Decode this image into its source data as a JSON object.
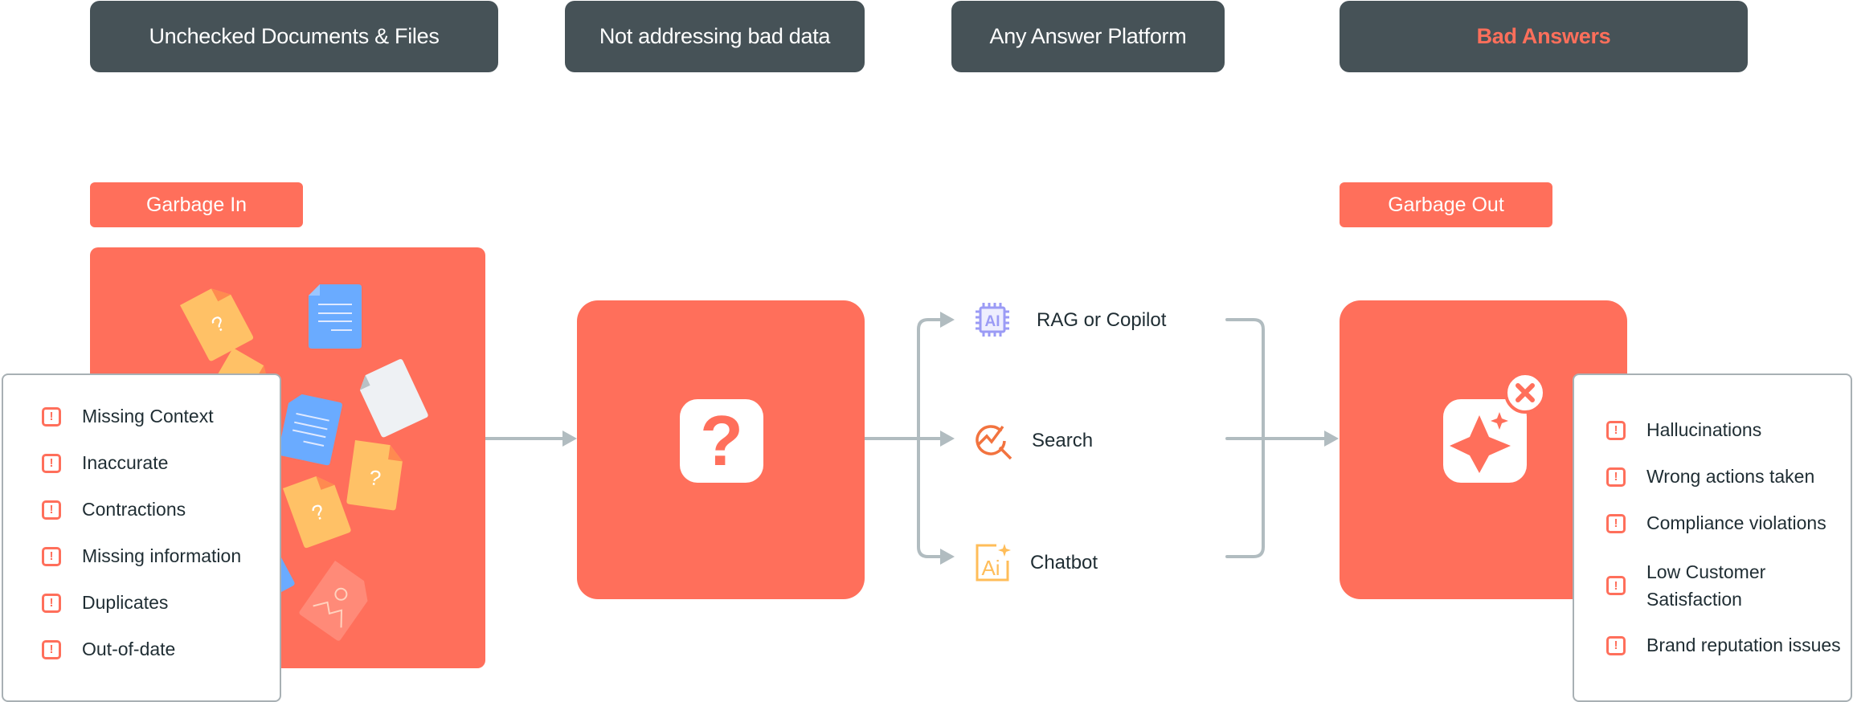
{
  "header": {
    "stages": [
      {
        "label": "Unchecked Documents & Files"
      },
      {
        "label": "Not addressing bad data"
      },
      {
        "label": "Any Answer Platform"
      },
      {
        "label": "Bad Answers"
      }
    ]
  },
  "input": {
    "tag": "Garbage In",
    "issues_title_icon": "warning-icon",
    "issues": [
      "Missing Context",
      "Inaccurate",
      "Contractions",
      "Missing information",
      "Duplicates",
      "Out-of-date"
    ]
  },
  "process": {
    "icon": "question-mark-icon",
    "icon_glyph": "?"
  },
  "platforms": [
    {
      "label": "RAG or Copilot",
      "icon": "ai-chip-icon",
      "icon_color": "#9b9bf5"
    },
    {
      "label": "Search",
      "icon": "search-analytics-icon",
      "icon_color": "#f2733f"
    },
    {
      "label": "Chatbot",
      "icon": "ai-sparkle-icon",
      "icon_color": "#ffbd59"
    }
  ],
  "output": {
    "tag": "Garbage Out",
    "icon": "sparkle-icon",
    "badge_icon": "close-icon",
    "issues": [
      "Hallucinations",
      "Wrong actions taken",
      "Compliance violations",
      "Low Customer Satisfaction",
      "Brand reputation issues"
    ]
  },
  "colors": {
    "accent": "#ff6f5b",
    "header_bg": "#465257",
    "connector": "#b1bcc0",
    "doc_yellow": "#ffc166",
    "doc_blue": "#6aabff",
    "doc_white": "#eef1f4"
  },
  "warning_glyph": "!"
}
